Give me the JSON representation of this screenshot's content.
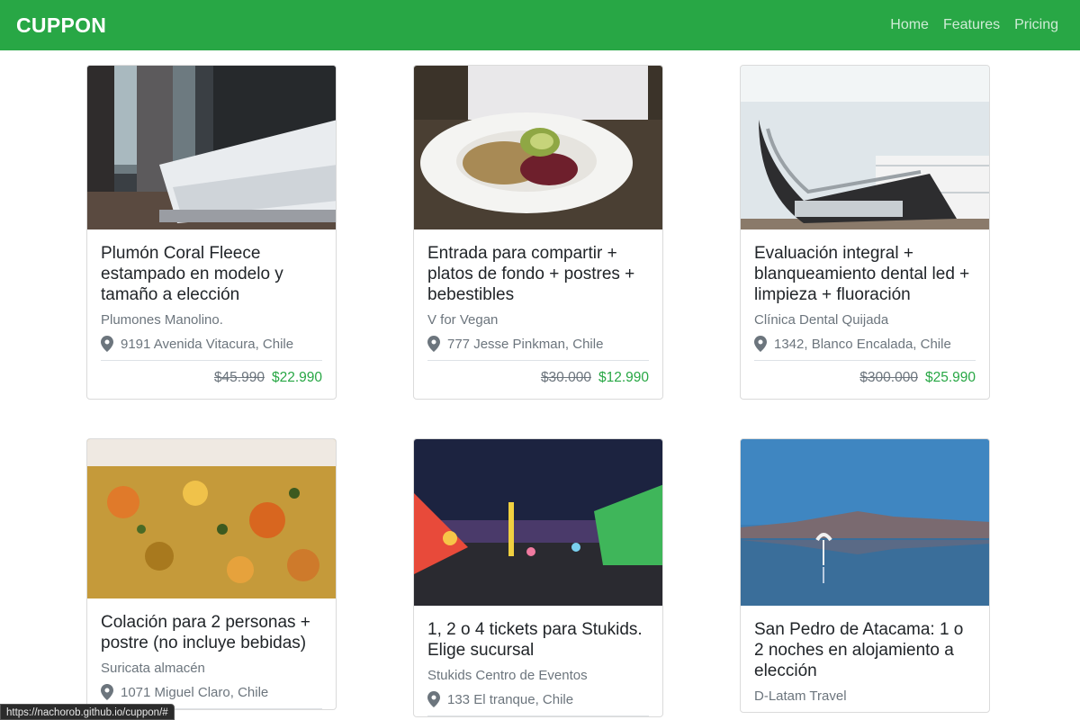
{
  "navbar": {
    "brand": "CUPPON",
    "links": [
      "Home",
      "Features",
      "Pricing"
    ],
    "color": "#28a745"
  },
  "deals": [
    {
      "title": "Plumón Coral Fleece estampado en modelo y tamaño a elección",
      "vendor": "Plumones Manolino.",
      "address": "9191 Avenida Vitacura, Chile",
      "old_price": "$45.990",
      "new_price": "$22.990",
      "image": "bed-photo"
    },
    {
      "title": "Entrada para compartir + platos de fondo + postres + bebestibles",
      "vendor": "V for Vegan",
      "address": "777 Jesse Pinkman, Chile",
      "old_price": "$30.000",
      "new_price": "$12.990",
      "image": "salad-photo"
    },
    {
      "title": "Evaluación integral + blanqueamiento dental led + limpieza + fluoración",
      "vendor": "Clínica Dental Quijada",
      "address": "1342, Blanco Encalada, Chile",
      "old_price": "$300.000",
      "new_price": "$25.990",
      "image": "dental-chair-photo"
    },
    {
      "title": "Colación para 2 personas + postre (no incluye bebidas)",
      "vendor": "Suricata almacén",
      "address": "1071 Miguel Claro, Chile",
      "image": "stew-photo"
    },
    {
      "title": "1, 2 o 4 tickets para Stukids. Elige sucursal",
      "vendor": "Stukids Centro de Eventos",
      "address": "133 El tranque, Chile",
      "image": "fair-photo"
    },
    {
      "title": "San Pedro de Atacama: 1 o 2 noches en alojamiento a elección",
      "vendor": "D-Latam Travel",
      "image": "flamingo-lake-photo"
    }
  ],
  "status_url": "https://nachorob.github.io/cuppon/#"
}
